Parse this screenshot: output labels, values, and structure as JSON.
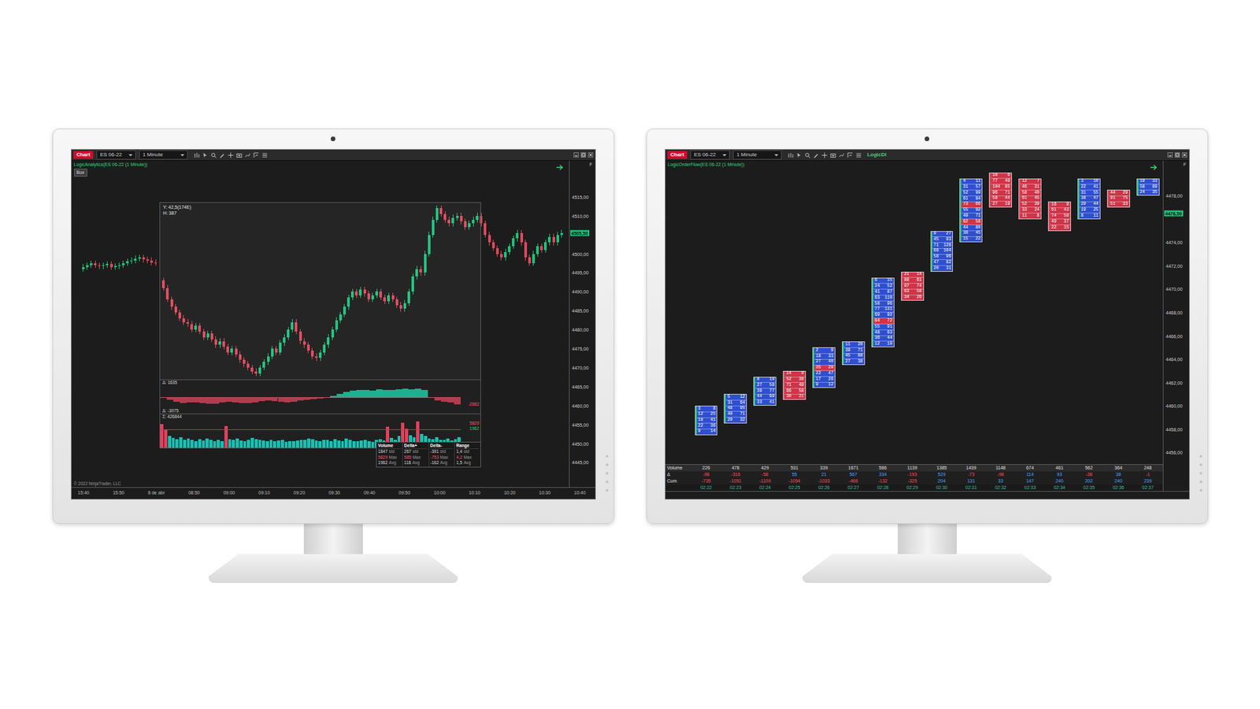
{
  "monitors": [
    {
      "kind": "analytics",
      "toolbar": {
        "tab": "Chart",
        "instrument": "ES 06-22",
        "interval": "1 Minute"
      },
      "indicator": "LogicAnalytics(ES 06-22 (1 Minute))",
      "box_button": "Box",
      "corner": "F",
      "price_range": [
        4438.5,
        4524.5
      ],
      "price_ticks": [
        {
          "label": "4515,00",
          "value": 4515
        },
        {
          "label": "4510,00",
          "value": 4510
        },
        {
          "label": "4500,00",
          "value": 4500
        },
        {
          "label": "4495,00",
          "value": 4495
        },
        {
          "label": "4490,00",
          "value": 4490
        },
        {
          "label": "4485,00",
          "value": 4485
        },
        {
          "label": "4480,00",
          "value": 4480
        },
        {
          "label": "4475,00",
          "value": 4475
        },
        {
          "label": "4470,00",
          "value": 4470
        },
        {
          "label": "4465,00",
          "value": 4465
        },
        {
          "label": "4460,00",
          "value": 4460
        },
        {
          "label": "4455,00",
          "value": 4455
        },
        {
          "label": "4450,00",
          "value": 4450
        },
        {
          "label": "4445,00",
          "value": 4445
        }
      ],
      "last_price": {
        "label": "4505,50",
        "value": 4505.5
      },
      "sessions": [
        {
          "open": 4496,
          "closes": [
            4496.5,
            4497,
            4497.5,
            4497,
            4496.75,
            4497,
            4497.25,
            4496.5,
            4496.75,
            4497,
            4497.5,
            4498,
            4498.25,
            4498.75,
            4499,
            4498.5,
            4498.25,
            4497.75,
            4497.5
          ]
        },
        {
          "open": 4493,
          "closes": [
            4491,
            4488,
            4486,
            4484.5,
            4483,
            4482,
            4481.5,
            4480,
            4481,
            4479.5,
            4478,
            4479,
            4477.5,
            4476,
            4477,
            4475.5,
            4474,
            4475,
            4473.5,
            4472,
            4471,
            4470,
            4469,
            4468.5,
            4470,
            4471.5,
            4473,
            4475,
            4474,
            4476.5,
            4478,
            4480,
            4482,
            4479.5,
            4477,
            4476,
            4474.5,
            4473,
            4472.5,
            4474,
            4476,
            4478,
            4480,
            4482.5,
            4484,
            4486,
            4488.5,
            4490,
            4489,
            4490.5,
            4489.5,
            4488,
            4489,
            4490,
            4488.5,
            4487.5,
            4489,
            4488,
            4486.5,
            4485.5,
            4487,
            4490,
            4494,
            4496,
            4495,
            4500,
            4505,
            4509,
            4512,
            4510.5,
            4509,
            4508,
            4509.5,
            4510,
            4508.5,
            4507,
            4508,
            4509,
            4510,
            4508,
            4505,
            4503,
            4501.5,
            4500,
            4499,
            4500.5,
            4502,
            4504,
            4505.5,
            4503,
            4499,
            4497.5,
            4500,
            4502,
            4501,
            4503,
            4504.5,
            4503,
            4505,
            4505.5
          ]
        }
      ],
      "time_ticks": [
        "15:40",
        "15:50",
        "8 de abr",
        "08:50",
        "09:00",
        "09:10",
        "09:20",
        "09:30",
        "09:40",
        "09:50",
        "10:00",
        "10:10",
        "10:20",
        "10:30",
        "10:40"
      ],
      "copyright": "© 2022 NinjaTrader, LLC",
      "overlay": {
        "readouts": [
          "Y: 42,5(174E)",
          "H: 387"
        ],
        "delta": {
          "top_label": "Δ: 1635",
          "bottom_label": "Δ: -3075",
          "side_label": "-2682",
          "scale": 1700,
          "values": [
            -150,
            -500,
            -800,
            -950,
            -900,
            -850,
            -950,
            -1100,
            -1050,
            -900,
            -750,
            -850,
            -950,
            -1000,
            -900,
            -700,
            -600,
            -700,
            -800,
            -850,
            -750,
            -600,
            -450,
            -350,
            -250,
            -100,
            150,
            450,
            750,
            950,
            1050,
            1100,
            1000,
            1150,
            1100,
            1050,
            1200,
            1250,
            1150,
            1300,
            1100,
            -200,
            -550,
            -750,
            -850,
            -1150
          ]
        },
        "volume": {
          "label": "Σ: 426844",
          "side_labels": [
            "5829",
            "1962"
          ],
          "alert": 4000,
          "scale": 6000,
          "values": [
            5200,
            4100,
            2600,
            2200,
            1900,
            2400,
            1800,
            2100,
            1700,
            1500,
            1900,
            1600,
            2000,
            1800,
            1400,
            1700,
            1500,
            4800,
            1900,
            1700,
            2100,
            1600,
            1500,
            1800,
            2200,
            1900,
            1700,
            1600,
            1400,
            1800,
            1500,
            1600,
            1700,
            1300,
            1500,
            1400,
            1600,
            1800,
            1700,
            2100,
            1900,
            1600,
            1500,
            1700,
            1800,
            1400,
            1900,
            1600,
            1500,
            2000,
            1700,
            1500,
            1400,
            1600,
            1800,
            1500,
            1300,
            1700,
            1900,
            1600,
            4700,
            2200,
            1800,
            2600,
            5600,
            4300,
            2800,
            2400,
            5800,
            3100,
            2600,
            2100,
            1900,
            2300,
            1800,
            1700,
            2000,
            1600,
            1900,
            2400
          ]
        },
        "stats": {
          "columns": [
            {
              "title": "Volume",
              "cells": [
                [
                  "1847",
                  "std"
                ],
                [
                  "5829",
                  "Max"
                ],
                [
                  "1962",
                  "Avg"
                ]
              ]
            },
            {
              "title": "Delta+",
              "cells": [
                [
                  "267",
                  "std"
                ],
                [
                  "585",
                  "Max"
                ],
                [
                  "118",
                  "Avg"
                ]
              ]
            },
            {
              "title": "Delta-",
              "cells": [
                [
                  "-391",
                  "std"
                ],
                [
                  "-753",
                  "Max"
                ],
                [
                  "-162",
                  "Avg"
                ]
              ]
            },
            {
              "title": "Range",
              "cells": [
                [
                  "1,4",
                  "std"
                ],
                [
                  "4,2",
                  "Max"
                ],
                [
                  "1,5",
                  "Avg"
                ]
              ]
            }
          ]
        }
      }
    },
    {
      "kind": "orderflow",
      "toolbar": {
        "tab": "Chart",
        "instrument": "ES 06-22",
        "interval": "1 Minute",
        "badge": "LogicDI"
      },
      "indicator": "LogicOrderFlow(ES 06-22 (1 Minute))",
      "corner": "F",
      "price_range": [
        4455,
        4481
      ],
      "price_ticks": [
        {
          "label": "4478,00",
          "value": 4478
        },
        {
          "label": "4474,00",
          "value": 4474
        },
        {
          "label": "4472,00",
          "value": 4472
        },
        {
          "label": "4470,00",
          "value": 4470
        },
        {
          "label": "4468,00",
          "value": 4468
        },
        {
          "label": "4466,00",
          "value": 4466
        },
        {
          "label": "4464,00",
          "value": 4464
        },
        {
          "label": "4462,00",
          "value": 4462
        },
        {
          "label": "4460,00",
          "value": 4460
        },
        {
          "label": "4458,00",
          "value": 4458
        },
        {
          "label": "4456,00",
          "value": 4456
        }
      ],
      "last_price": {
        "label": "4476,50",
        "value": 4476.5
      },
      "row_size": 0.5,
      "bars": [
        {
          "high": 4460.0,
          "kind": "up",
          "rows": [
            [
              "3",
              "8"
            ],
            [
              "12",
              "25"
            ],
            [
              "18",
              "41"
            ],
            [
              "22",
              "36"
            ],
            [
              "9",
              "14"
            ]
          ]
        },
        {
          "high": 4461.0,
          "kind": "up",
          "rows": [
            [
              "5",
              "12"
            ],
            [
              "31",
              "64"
            ],
            [
              "48",
              "95"
            ],
            [
              "40",
              "71"
            ],
            [
              "20",
              "32"
            ]
          ]
        },
        {
          "high": 4462.5,
          "kind": "up",
          "rows": [
            [
              "8",
              "19"
            ],
            [
              "27",
              "58"
            ],
            [
              "39",
              "77"
            ],
            [
              "44",
              "69"
            ],
            [
              "33",
              "41"
            ]
          ]
        },
        {
          "high": 4463.0,
          "kind": "down",
          "rows": [
            [
              "14",
              "9"
            ],
            [
              "52",
              "38"
            ],
            [
              "71",
              "49"
            ],
            [
              "66",
              "58"
            ],
            [
              "30",
              "21"
            ]
          ]
        },
        {
          "high": 4465.0,
          "kind": "up",
          "rows": [
            [
              "2",
              "9"
            ],
            [
              "18",
              "33"
            ],
            [
              "27",
              "40"
            ],
            [
              "35",
              "29"
            ],
            [
              "22",
              "47"
            ],
            [
              "17",
              "26"
            ],
            [
              "9",
              "12"
            ]
          ]
        },
        {
          "high": 4465.5,
          "kind": "up",
          "rows": [
            [
              "11",
              "20"
            ],
            [
              "39",
              "71"
            ],
            [
              "45",
              "88"
            ],
            [
              "27",
              "38"
            ]
          ]
        },
        {
          "high": 4471.0,
          "kind": "up",
          "rows": [
            [
              "6",
              "15"
            ],
            [
              "24",
              "52"
            ],
            [
              "41",
              "87"
            ],
            [
              "63",
              "110"
            ],
            [
              "58",
              "96"
            ],
            [
              "77",
              "131"
            ],
            [
              "69",
              "92"
            ],
            [
              "84",
              "72"
            ],
            [
              "55",
              "91"
            ],
            [
              "48",
              "63"
            ],
            [
              "36",
              "44"
            ],
            [
              "12",
              "19"
            ]
          ]
        },
        {
          "high": 4471.5,
          "kind": "down",
          "rows": [
            [
              "21",
              "14"
            ],
            [
              "88",
              "61"
            ],
            [
              "97",
              "74"
            ],
            [
              "63",
              "58"
            ],
            [
              "34",
              "26"
            ]
          ]
        },
        {
          "high": 4475.0,
          "kind": "up",
          "rows": [
            [
              "9",
              "27"
            ],
            [
              "45",
              "93"
            ],
            [
              "71",
              "128"
            ],
            [
              "66",
              "104"
            ],
            [
              "58",
              "96"
            ],
            [
              "47",
              "82"
            ],
            [
              "20",
              "31"
            ]
          ]
        },
        {
          "high": 4479.5,
          "kind": "up",
          "rows": [
            [
              "4",
              "11"
            ],
            [
              "31",
              "57"
            ],
            [
              "52",
              "99"
            ],
            [
              "61",
              "84"
            ],
            [
              "73",
              "66"
            ],
            [
              "55",
              "92"
            ],
            [
              "49",
              "71"
            ],
            [
              "62",
              "58"
            ],
            [
              "44",
              "80"
            ],
            [
              "38",
              "45"
            ],
            [
              "15",
              "22"
            ]
          ]
        },
        {
          "high": 4480.0,
          "kind": "down",
          "rows": [
            [
              "18",
              "6"
            ],
            [
              "77",
              "49"
            ],
            [
              "104",
              "85"
            ],
            [
              "96",
              "71"
            ],
            [
              "58",
              "44"
            ],
            [
              "27",
              "19"
            ]
          ]
        },
        {
          "high": 4479.5,
          "kind": "down",
          "rows": [
            [
              "12",
              "7"
            ],
            [
              "46",
              "31"
            ],
            [
              "58",
              "40"
            ],
            [
              "61",
              "45"
            ],
            [
              "52",
              "39"
            ],
            [
              "33",
              "24"
            ],
            [
              "11",
              "8"
            ]
          ]
        },
        {
          "high": 4477.5,
          "kind": "down",
          "rows": [
            [
              "16",
              "9"
            ],
            [
              "61",
              "43"
            ],
            [
              "74",
              "58"
            ],
            [
              "49",
              "37"
            ],
            [
              "22",
              "15"
            ]
          ]
        },
        {
          "high": 4479.5,
          "kind": "up",
          "rows": [
            [
              "3",
              "10"
            ],
            [
              "22",
              "41"
            ],
            [
              "31",
              "55"
            ],
            [
              "38",
              "47"
            ],
            [
              "29",
              "44"
            ],
            [
              "19",
              "25"
            ],
            [
              "8",
              "11"
            ]
          ]
        },
        {
          "high": 4478.5,
          "kind": "down",
          "rows": [
            [
              "44",
              "29"
            ],
            [
              "91",
              "75"
            ],
            [
              "51",
              "33"
            ]
          ]
        },
        {
          "high": 4479.5,
          "kind": "up",
          "rows": [
            [
              "19",
              "33"
            ],
            [
              "58",
              "89"
            ],
            [
              "24",
              "35"
            ]
          ]
        }
      ],
      "summary": {
        "rows": [
          {
            "label": "Volume",
            "kind": "plain",
            "values": [
              "226",
              "478",
              "429",
              "531",
              "339",
              "1671",
              "586",
              "1139",
              "1385",
              "1439",
              "1148",
              "674",
              "461",
              "562",
              "364",
              "248"
            ]
          },
          {
            "label": "Δ",
            "kind": "signed",
            "values": [
              "-98",
              "-316",
              "-58",
              "55",
              "21",
              "567",
              "334",
              "-193",
              "529",
              "-73",
              "-98",
              "114",
              "93",
              "-38",
              "38",
              "-1"
            ]
          },
          {
            "label": "Cum",
            "kind": "signed",
            "values": [
              "-735",
              "-1051",
              "-1109",
              "-1054",
              "-1033",
              "-466",
              "-132",
              "-325",
              "204",
              "131",
              "33",
              "147",
              "240",
              "202",
              "240",
              "239"
            ]
          }
        ],
        "times": [
          "02:22",
          "02:23",
          "02:24",
          "02:25",
          "02:26",
          "02:27",
          "02:28",
          "02:29",
          "02:30",
          "02:31",
          "02:32",
          "02:33",
          "02:34",
          "02:35",
          "02:36",
          "02:37"
        ]
      }
    }
  ]
}
